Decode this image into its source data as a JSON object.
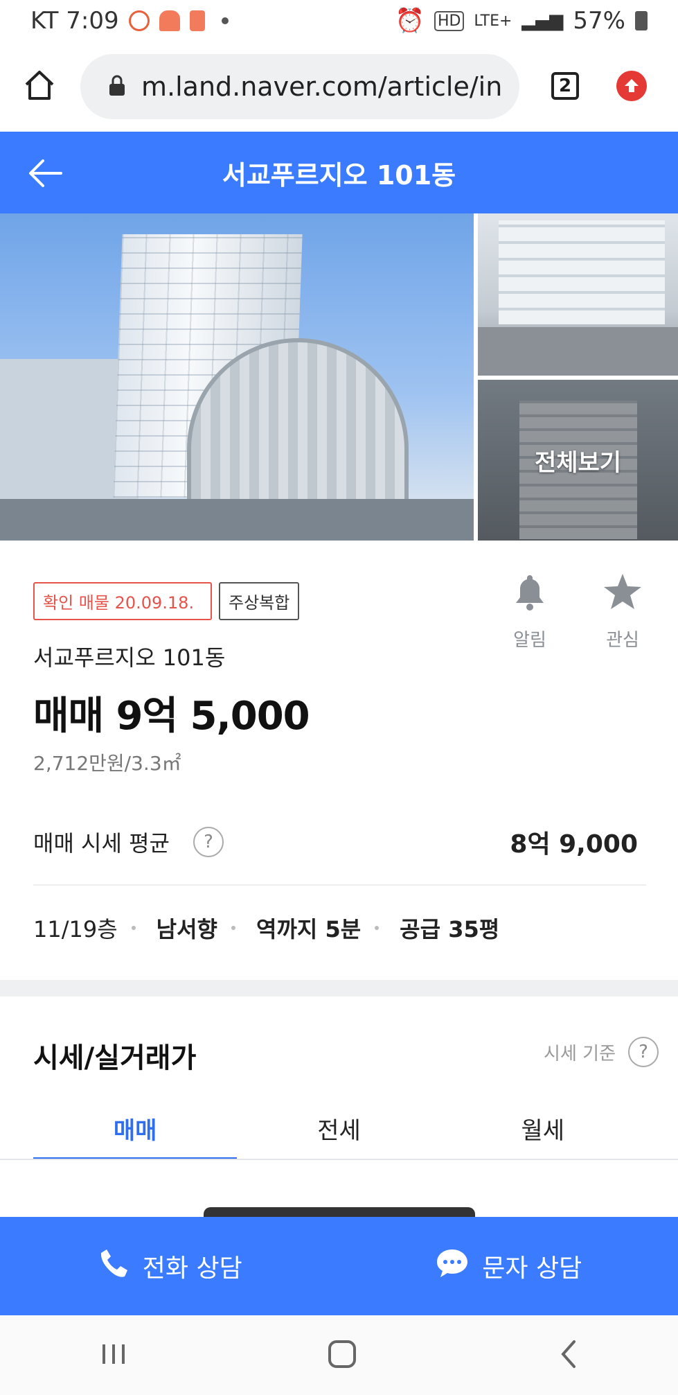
{
  "status_bar": {
    "carrier_time": "KT 7:09",
    "network": "LTE+",
    "battery": "57%"
  },
  "browser": {
    "url": "m.land.naver.com/article/in",
    "tab_count": "2"
  },
  "header": {
    "title": "서교푸르지오 101동"
  },
  "photos": {
    "view_all": "전체보기"
  },
  "listing": {
    "verified_badge": "확인 매물 20.09.18.",
    "type_badge": "주상복합",
    "building_name": "서교푸르지오 101동",
    "price": "매매 9억 5,000",
    "price_per_area": "2,712만원/3.3㎡",
    "avg_label": "매매 시세 평균",
    "avg_value": "8억 9,000",
    "floor": "11/19층",
    "direction": "남서향",
    "station": "역까지 5분",
    "supply": "공급 35평"
  },
  "actions": {
    "alert": "알림",
    "favorite": "관심"
  },
  "section": {
    "title": "시세/실거래가",
    "basis": "시세 기준",
    "tabs": [
      "매매",
      "전세",
      "월세"
    ]
  },
  "cta": {
    "call": "전화 상담",
    "message": "문자 상담"
  },
  "colors": {
    "brand": "#3b7bff",
    "tab_active": "#2f6fef",
    "badge_red": "#e5534b"
  }
}
